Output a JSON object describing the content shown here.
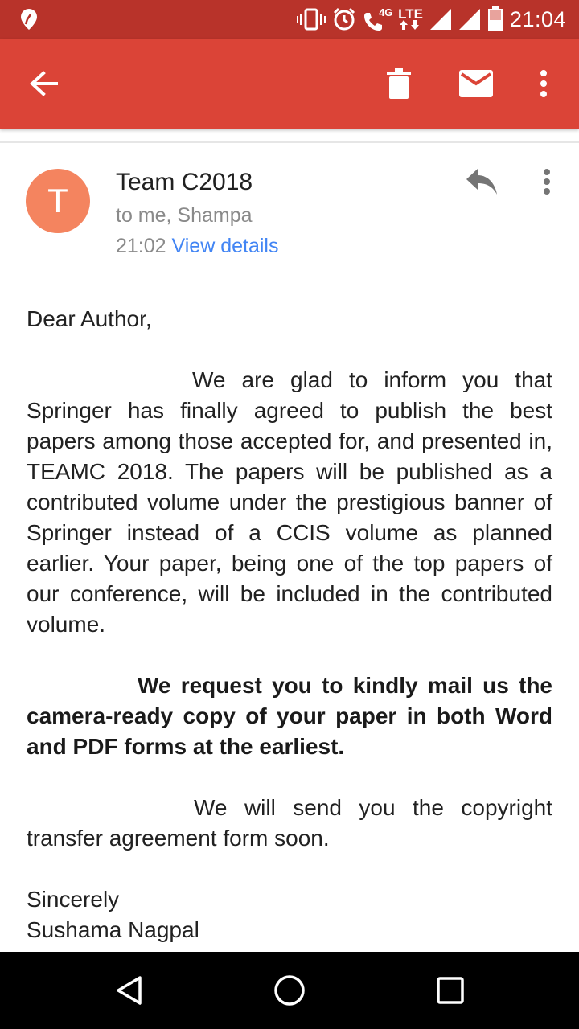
{
  "status_bar": {
    "time": "21:04",
    "network_4g": "4G",
    "network_lte": "LTE",
    "icons": [
      "location-icon",
      "vibrate-icon",
      "alarm-icon",
      "wifi-calling-icon",
      "signal-icon",
      "battery-icon"
    ]
  },
  "toolbar": {
    "back_icon": "back-arrow-icon",
    "delete_icon": "delete-icon",
    "mark_unread_icon": "mail-icon",
    "more_icon": "more-vert-icon"
  },
  "email": {
    "avatar_letter": "T",
    "sender": "Team C2018",
    "recipients": "to me, Shampa",
    "time": "21:02",
    "view_details": "View details",
    "greeting": "Dear Author,",
    "paragraph1": "We are glad to inform you that Springer has finally agreed to publish the best papers among those accepted for, and presented in, TEAMC 2018. The papers will be published as a contributed volume under the prestigious banner of Springer instead of a CCIS volume as planned earlier. Your paper, being one of the top papers of our conference, will be included in the contributed volume.",
    "paragraph2": "We request you to kindly mail us the camera-ready copy of your paper in both Word and PDF forms at the earliest.",
    "paragraph3": "We will send you the copyright transfer agreement form soon.",
    "closing": "Sincerely",
    "signature": "Sushama Nagpal"
  },
  "colors": {
    "status_bar": "#b8332a",
    "toolbar": "#db4437",
    "avatar": "#f4845f",
    "link": "#4285f4"
  },
  "nav_bar": {
    "icons": [
      "back-triangle-icon",
      "home-circle-icon",
      "recents-square-icon"
    ]
  }
}
